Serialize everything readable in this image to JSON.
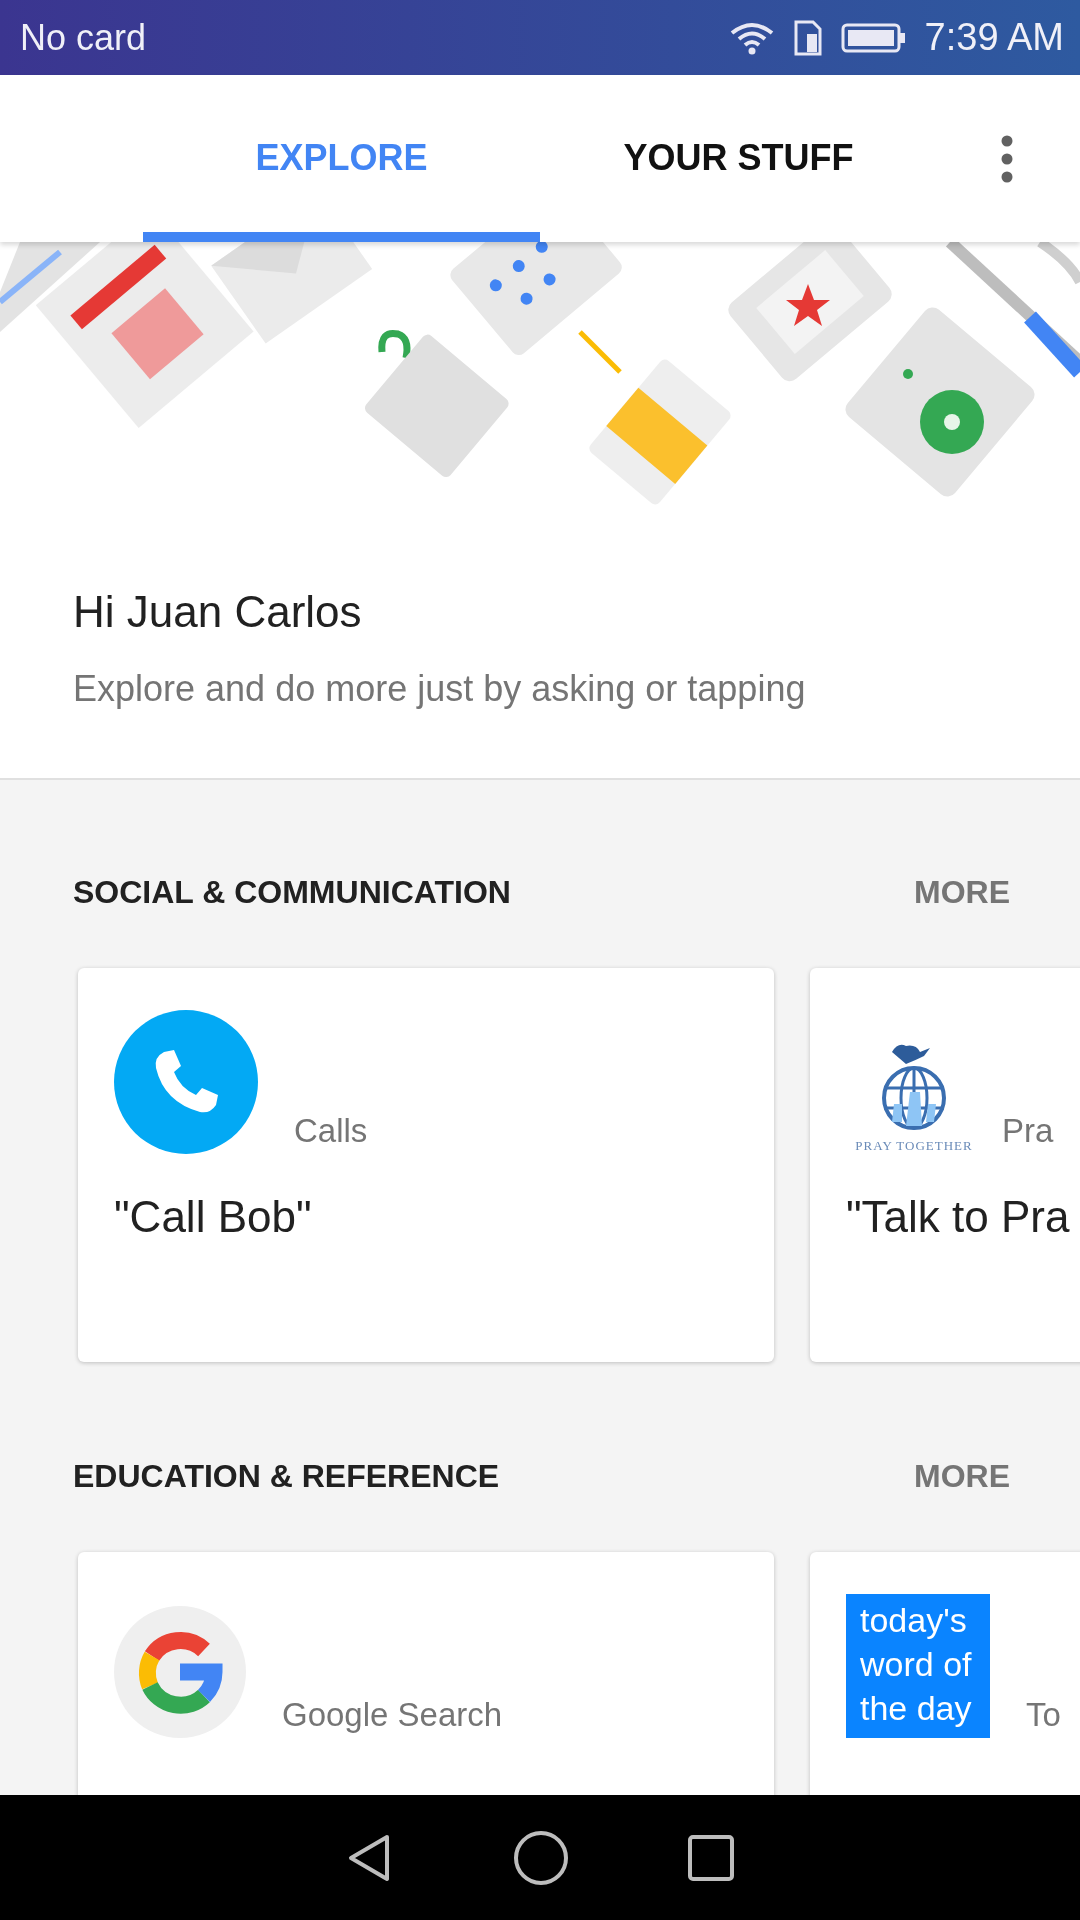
{
  "status_bar": {
    "carrier": "No card",
    "time": "7:39 AM"
  },
  "tabs": [
    {
      "label": "EXPLORE",
      "selected": true
    },
    {
      "label": "YOUR STUFF",
      "selected": false
    }
  ],
  "greeting": {
    "title": "Hi Juan Carlos",
    "subtitle": "Explore and do more just by asking or tapping"
  },
  "sections": [
    {
      "title": "SOCIAL & COMMUNICATION",
      "more": "MORE",
      "cards": [
        {
          "kind": "phone",
          "app": "Calls",
          "query": "\"Call Bob\""
        },
        {
          "kind": "pray",
          "logo_text": "PRAY TOGETHER",
          "app": "Pra",
          "query": "\"Talk to Pra"
        }
      ]
    },
    {
      "title": "EDUCATION & REFERENCE",
      "more": "MORE",
      "cards": [
        {
          "kind": "google",
          "app": "Google Search"
        },
        {
          "kind": "word",
          "logo_text": "today's word of the day",
          "app": "To"
        }
      ]
    }
  ]
}
